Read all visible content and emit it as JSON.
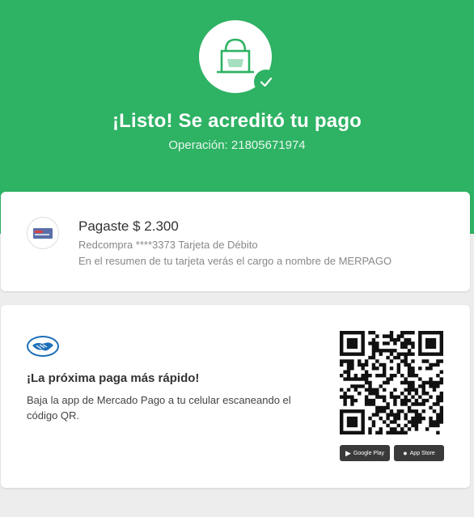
{
  "header": {
    "title": "¡Listo! Se acreditó tu pago",
    "operation": "Operación: 21805671974",
    "color": "#2eb264"
  },
  "payment": {
    "amount": "Pagaste $ 2.300",
    "method": "Redcompra ****3373 Tarjeta de Débito",
    "note": "En el resumen de tu tarjeta verás el cargo a nombre de MERPAGO"
  },
  "promo": {
    "title": "¡La próxima paga más rápido!",
    "text": "Baja la app de Mercado Pago a tu celular escaneando el código QR.",
    "google_play": "Google Play",
    "app_store": "App Store"
  }
}
